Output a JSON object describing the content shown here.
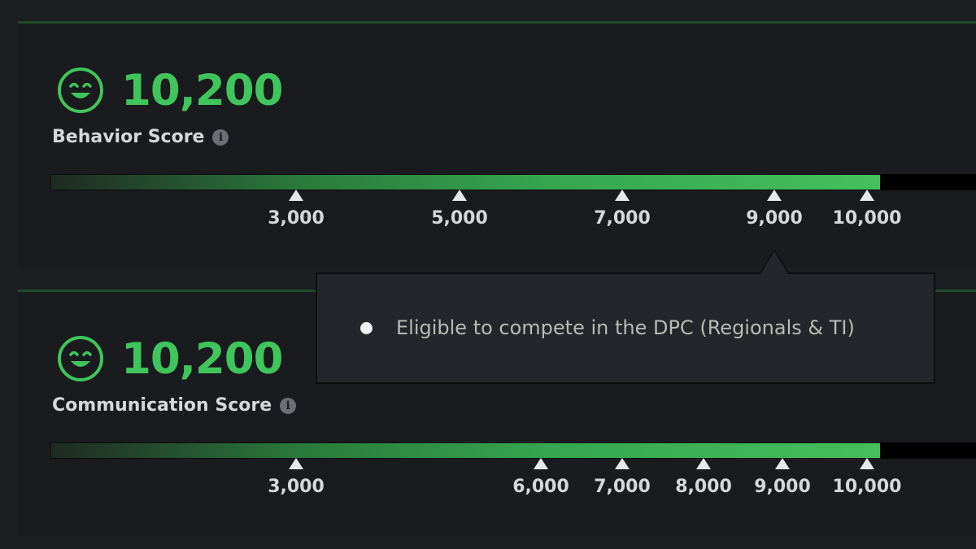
{
  "behavior": {
    "score": "10,200",
    "label": "Behavior Score",
    "icon": "smiley-face-icon",
    "info_icon_glyph": "i",
    "progress_fraction": 0.88,
    "markers": [
      "3,000",
      "5,000",
      "7,000",
      "9,000",
      "10,000"
    ]
  },
  "communication": {
    "score": "10,200",
    "label": "Communication Score",
    "icon": "smiley-face-icon",
    "info_icon_glyph": "i",
    "progress_fraction": 0.88,
    "markers": [
      "3,000",
      "6,000",
      "7,000",
      "8,000",
      "9,000",
      "10,000"
    ]
  },
  "tooltip": {
    "text": "Eligible to compete in the DPC (Regionals & TI)"
  },
  "colors": {
    "score_green": "#3fc55b",
    "bar_green": "#45c05c",
    "panel_bg": "#191b1e",
    "panel_border": "#1f4a28"
  }
}
